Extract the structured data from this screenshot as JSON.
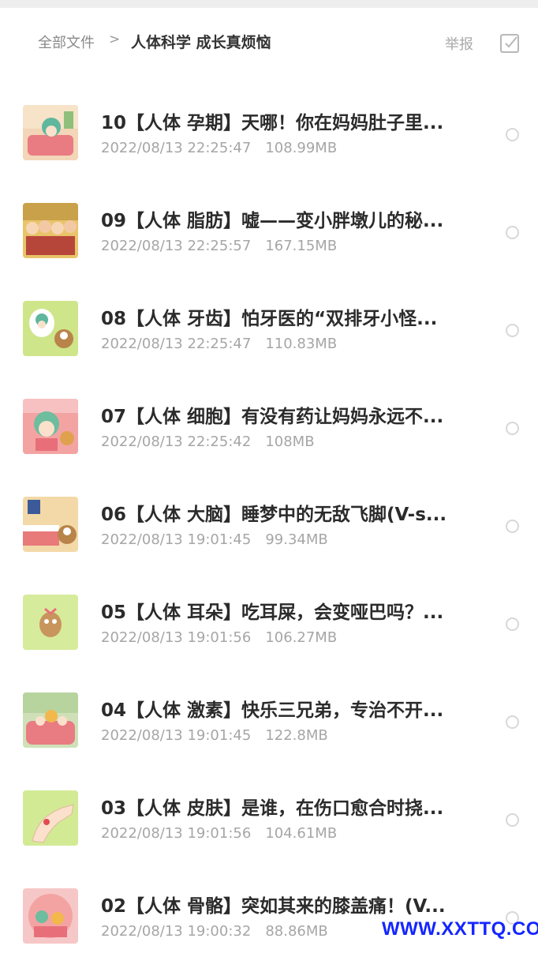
{
  "header": {
    "breadcrumb_root": "全部文件",
    "breadcrumb_separator": ">",
    "breadcrumb_current": "人体科学 成长真烦恼",
    "report_label": "举报",
    "select_icon": "checkbox-square-icon"
  },
  "files": [
    {
      "title": "10【人体 孕期】天哪！你在妈妈肚子里...",
      "date": "2022/08/13 22:25:47",
      "size": "108.99MB",
      "thumb": "thumbnail-cartoon-pink-room"
    },
    {
      "title": "09【人体 脂肪】嘘——变小胖墩儿的秘...",
      "date": "2022/08/13 22:25:57",
      "size": "167.15MB",
      "thumb": "thumbnail-cartoon-crowd"
    },
    {
      "title": "08【人体 牙齿】怕牙医的“双排牙小怪...",
      "date": "2022/08/13 22:25:47",
      "size": "110.83MB",
      "thumb": "thumbnail-cartoon-green-tooth"
    },
    {
      "title": "07【人体 细胞】有没有药让妈妈永远不...",
      "date": "2022/08/13 22:25:42",
      "size": "108MB",
      "thumb": "thumbnail-cartoon-pink-character"
    },
    {
      "title": "06【人体 大脑】睡梦中的无敌飞脚(V-s...",
      "date": "2022/08/13 19:01:45",
      "size": "99.34MB",
      "thumb": "thumbnail-cartoon-bedroom"
    },
    {
      "title": "05【人体 耳朵】吃耳屎，会变哑巴吗？...",
      "date": "2022/08/13 19:01:56",
      "size": "106.27MB",
      "thumb": "thumbnail-cartoon-ear"
    },
    {
      "title": "04【人体 激素】快乐三兄弟，专治不开...",
      "date": "2022/08/13 19:01:45",
      "size": "122.8MB",
      "thumb": "thumbnail-cartoon-sofa"
    },
    {
      "title": "03【人体 皮肤】是谁，在伤口愈合时挠...",
      "date": "2022/08/13 19:01:56",
      "size": "104.61MB",
      "thumb": "thumbnail-cartoon-hand"
    },
    {
      "title": "02【人体 骨骼】突如其来的膝盖痛！(V...",
      "date": "2022/08/13 19:00:32",
      "size": "88.86MB",
      "thumb": "thumbnail-cartoon-knee"
    }
  ],
  "watermark": "WWW.XXTTQ.COM",
  "colors": {
    "title_text": "#2b2b2b",
    "meta_text": "#a6a6a6",
    "watermark": "#1426ff"
  }
}
